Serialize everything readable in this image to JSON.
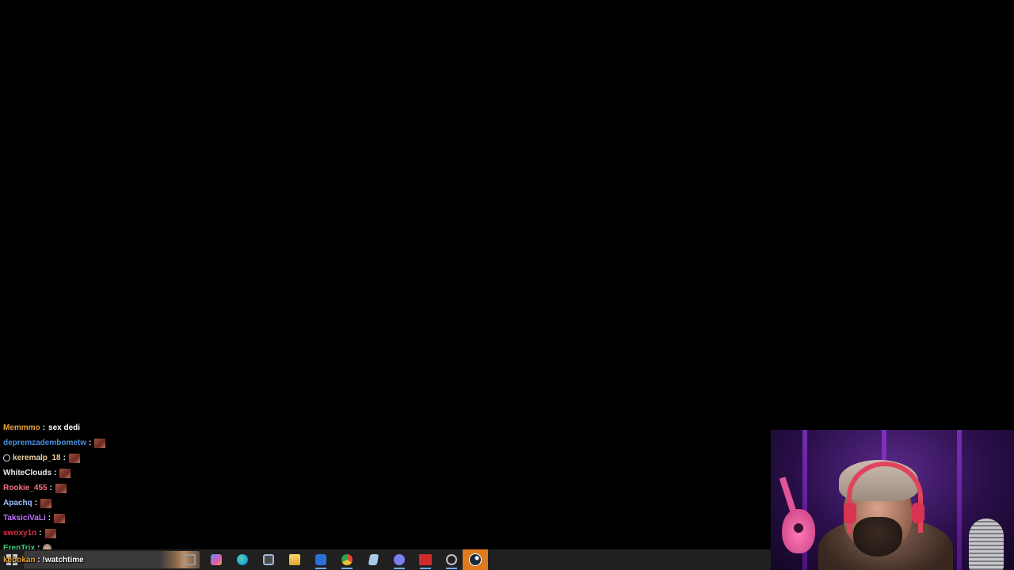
{
  "chat": {
    "messages": [
      {
        "user": "Memmmo",
        "sep": ":",
        "text": "sex dedi",
        "color": "#e8a23a",
        "emote": false,
        "badge": false
      },
      {
        "user": "depremzadembometw",
        "sep": ":",
        "text": "",
        "color": "#4a8fe0",
        "emote": true,
        "badge": false
      },
      {
        "user": "keremalp_18",
        "sep": ":",
        "text": "",
        "color": "#f0d0a0",
        "emote": true,
        "badge": true
      },
      {
        "user": "WhiteClouds",
        "sep": ":",
        "text": "",
        "color": "#e8e8f0",
        "emote": true,
        "badge": false
      },
      {
        "user": "Rookie_455",
        "sep": ":",
        "text": "",
        "color": "#ff6f8a",
        "emote": true,
        "badge": false
      },
      {
        "user": "Apachq",
        "sep": ":",
        "text": "",
        "color": "#9ac0ff",
        "emote": true,
        "badge": false
      },
      {
        "user": "TaksiciVaLi",
        "sep": ":",
        "text": "",
        "color": "#c070ff",
        "emote": true,
        "badge": false
      },
      {
        "user": "swoxy1n",
        "sep": ":",
        "text": "",
        "color": "#e0304a",
        "emote": true,
        "badge": false
      },
      {
        "user": "ErenTrix",
        "sep": ":",
        "text": "",
        "color": "#3ed07a",
        "emote": "hand",
        "badge": false
      }
    ],
    "last": {
      "user": "kebokan",
      "sep": ":",
      "text": "!watchtime",
      "color": "#e8a23a"
    }
  },
  "taskbar": {
    "items": [
      {
        "name": "task-view-icon",
        "color": "#9a9a9a"
      },
      {
        "name": "copilot-icon",
        "color": "#5a8cff"
      },
      {
        "name": "edge-icon",
        "color": "#1fa8d8"
      },
      {
        "name": "store-icon",
        "color": "#9fb8d8"
      },
      {
        "name": "file-explorer-icon",
        "color": "#f0c040"
      },
      {
        "name": "outlook-icon",
        "color": "#2a70d8"
      },
      {
        "name": "chrome-icon",
        "color": "#e04a3a"
      },
      {
        "name": "notepad-icon",
        "color": "#a8c8e8"
      },
      {
        "name": "discord-icon",
        "color": "#7a80f0"
      },
      {
        "name": "voicemeeter-icon",
        "color": "#d02a2a"
      },
      {
        "name": "speedometer-icon",
        "color": "#c0c0c0"
      },
      {
        "name": "steam-icon",
        "color": "#1b2838"
      }
    ]
  }
}
